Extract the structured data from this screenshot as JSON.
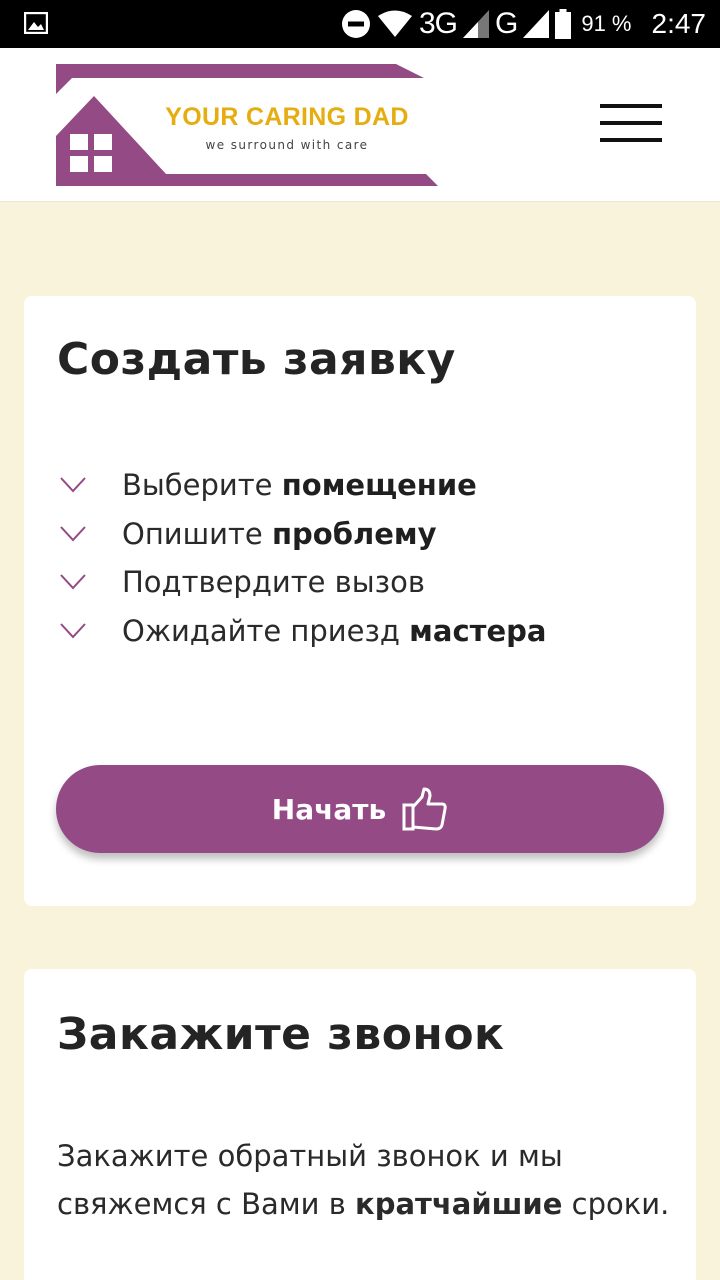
{
  "status_bar": {
    "network_3g": "3G",
    "network_g": "G",
    "battery_percent": "91 %",
    "time": "2:47"
  },
  "header": {
    "logo_title": "YOUR CARING DAD",
    "logo_tagline": "we surround with care",
    "brand_color": "#934a85",
    "logo_title_color": "#e6ad10"
  },
  "create_card": {
    "title": "Создать заявку",
    "steps": [
      {
        "text": "Выберите ",
        "bold": "помещение"
      },
      {
        "text": "Опишите ",
        "bold": "проблему"
      },
      {
        "text": "Подтвердите вызов",
        "bold": ""
      },
      {
        "text": "Ожидайте приезд ",
        "bold": "мастера"
      }
    ],
    "start_button_label": "Начать"
  },
  "callback_card": {
    "title": "Закажите звонок",
    "text_before": "Закажите обратный звонок и мы свяжемся с Вами в ",
    "text_bold": "кратчайшие",
    "text_after": " сроки."
  },
  "icons": {
    "step_icon": "chevron-down-icon",
    "start_icon": "thumbs-up-icon",
    "menu_icon": "hamburger-menu-icon"
  }
}
